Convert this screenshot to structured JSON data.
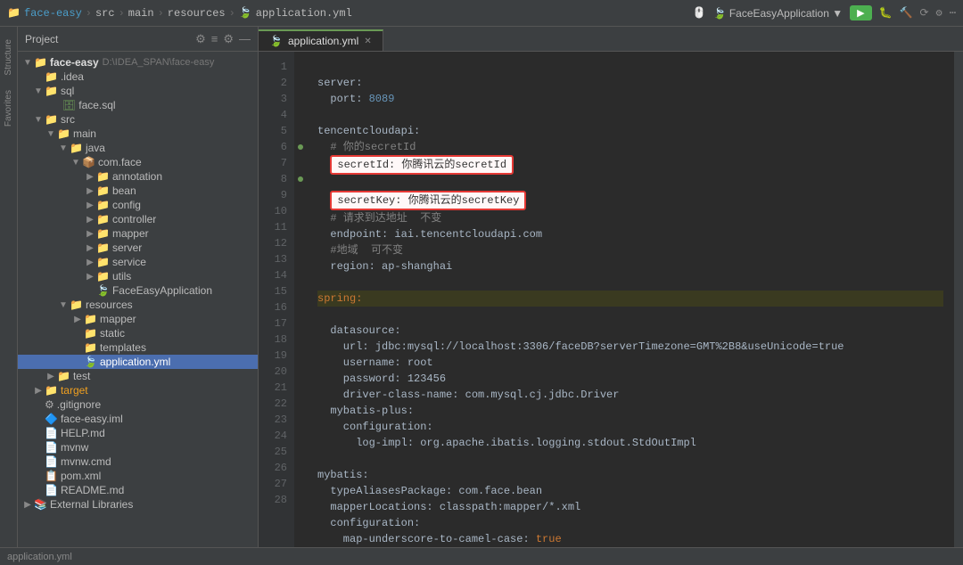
{
  "topbar": {
    "breadcrumb": [
      "face-easy",
      "src",
      "main",
      "resources",
      "application.yml"
    ],
    "app_name": "FaceEasyApplication",
    "run_icon": "▶",
    "debug_icon": "🐛",
    "build_icon": "🔨"
  },
  "sidebar": {
    "title": "Project",
    "tree": [
      {
        "id": "face-easy-root",
        "label": "face-easy",
        "path": "D:\\IDEA_SPAN\\face-easy",
        "type": "project",
        "level": 0,
        "expanded": true,
        "arrow": "▼"
      },
      {
        "id": "idea",
        "label": ".idea",
        "type": "folder",
        "level": 1,
        "expanded": false,
        "arrow": "▶"
      },
      {
        "id": "sql",
        "label": "sql",
        "type": "folder",
        "level": 1,
        "expanded": true,
        "arrow": "▼"
      },
      {
        "id": "face-sql",
        "label": "face.sql",
        "type": "sql",
        "level": 2,
        "expanded": false,
        "arrow": ""
      },
      {
        "id": "src",
        "label": "src",
        "type": "folder",
        "level": 1,
        "expanded": true,
        "arrow": "▼"
      },
      {
        "id": "main",
        "label": "main",
        "type": "folder",
        "level": 2,
        "expanded": true,
        "arrow": "▼"
      },
      {
        "id": "java",
        "label": "java",
        "type": "folder",
        "level": 3,
        "expanded": true,
        "arrow": "▼"
      },
      {
        "id": "com-face",
        "label": "com.face",
        "type": "package",
        "level": 4,
        "expanded": true,
        "arrow": "▼"
      },
      {
        "id": "annotation",
        "label": "annotation",
        "type": "folder",
        "level": 5,
        "expanded": false,
        "arrow": "▶"
      },
      {
        "id": "bean",
        "label": "bean",
        "type": "folder",
        "level": 5,
        "expanded": false,
        "arrow": "▶"
      },
      {
        "id": "config",
        "label": "config",
        "type": "folder",
        "level": 5,
        "expanded": false,
        "arrow": "▶"
      },
      {
        "id": "controller",
        "label": "controller",
        "type": "folder",
        "level": 5,
        "expanded": false,
        "arrow": "▶"
      },
      {
        "id": "mapper",
        "label": "mapper",
        "type": "folder",
        "level": 5,
        "expanded": false,
        "arrow": "▶"
      },
      {
        "id": "server",
        "label": "server",
        "type": "folder",
        "level": 5,
        "expanded": false,
        "arrow": "▶"
      },
      {
        "id": "service",
        "label": "service",
        "type": "folder",
        "level": 5,
        "expanded": false,
        "arrow": "▶"
      },
      {
        "id": "utils",
        "label": "utils",
        "type": "folder",
        "level": 5,
        "expanded": false,
        "arrow": "▶"
      },
      {
        "id": "FaceEasyApplication",
        "label": "FaceEasyApplication",
        "type": "app",
        "level": 5,
        "expanded": false,
        "arrow": ""
      },
      {
        "id": "resources",
        "label": "resources",
        "type": "folder",
        "level": 3,
        "expanded": true,
        "arrow": "▼"
      },
      {
        "id": "mapper-res",
        "label": "mapper",
        "type": "folder",
        "level": 4,
        "expanded": false,
        "arrow": "▶"
      },
      {
        "id": "static",
        "label": "static",
        "type": "folder",
        "level": 4,
        "expanded": false,
        "arrow": ""
      },
      {
        "id": "templates",
        "label": "templates",
        "type": "folder",
        "level": 4,
        "expanded": false,
        "arrow": ""
      },
      {
        "id": "application-yml",
        "label": "application.yml",
        "type": "yaml",
        "level": 4,
        "expanded": false,
        "arrow": "",
        "selected": true
      },
      {
        "id": "test",
        "label": "test",
        "type": "folder",
        "level": 2,
        "expanded": false,
        "arrow": "▶"
      },
      {
        "id": "target",
        "label": "target",
        "type": "folder",
        "level": 1,
        "expanded": false,
        "arrow": "▶",
        "highlight": true
      },
      {
        "id": "gitignore",
        "label": ".gitignore",
        "type": "git",
        "level": 1,
        "expanded": false,
        "arrow": ""
      },
      {
        "id": "face-easy-iml",
        "label": "face-easy.iml",
        "type": "iml",
        "level": 1,
        "expanded": false,
        "arrow": ""
      },
      {
        "id": "HELP-md",
        "label": "HELP.md",
        "type": "md",
        "level": 1,
        "expanded": false,
        "arrow": ""
      },
      {
        "id": "mvnw",
        "label": "mvnw",
        "type": "file",
        "level": 1,
        "expanded": false,
        "arrow": ""
      },
      {
        "id": "mvnw-cmd",
        "label": "mvnw.cmd",
        "type": "file",
        "level": 1,
        "expanded": false,
        "arrow": ""
      },
      {
        "id": "pom-xml",
        "label": "pom.xml",
        "type": "xml",
        "level": 1,
        "expanded": false,
        "arrow": ""
      },
      {
        "id": "README-md",
        "label": "README.md",
        "type": "md",
        "level": 1,
        "expanded": false,
        "arrow": ""
      },
      {
        "id": "External Libraries",
        "label": "External Libraries",
        "type": "folder",
        "level": 0,
        "expanded": false,
        "arrow": "▶"
      }
    ]
  },
  "editor": {
    "tab_label": "application.yml",
    "tab_icon": "yaml",
    "lines": [
      {
        "num": 1,
        "content": "server:",
        "type": "key"
      },
      {
        "num": 2,
        "content": "  port: 8089",
        "type": "keyval",
        "key": "  port",
        "val": " 8089"
      },
      {
        "num": 3,
        "content": "",
        "type": "empty"
      },
      {
        "num": 4,
        "content": "tencentcloudapi:",
        "type": "key"
      },
      {
        "num": 5,
        "content": "  # 你的secretId",
        "type": "comment"
      },
      {
        "num": 6,
        "content": "  secretId: 你腾讯云的secretId",
        "type": "keyval",
        "key": "  secretId",
        "val": " 你腾讯云的secretId",
        "redbox": true
      },
      {
        "num": 7,
        "content": "",
        "type": "empty"
      },
      {
        "num": 8,
        "content": "  secretKey: 你腾讯云的secretKey",
        "type": "keyval",
        "key": "  secretKey",
        "val": " 你腾讯云的secretKey",
        "redbox": true
      },
      {
        "num": 9,
        "content": "  # 请求到达地址  不变",
        "type": "comment"
      },
      {
        "num": 10,
        "content": "  endpoint: iai.tencentcloudapi.com",
        "type": "keyval",
        "key": "  endpoint",
        "val": " iai.tencentcloudapi.com"
      },
      {
        "num": 11,
        "content": "  #地域  可不变",
        "type": "comment"
      },
      {
        "num": 12,
        "content": "  region: ap-shanghai",
        "type": "keyval",
        "key": "  region",
        "val": " ap-shanghai"
      },
      {
        "num": 13,
        "content": "",
        "type": "empty"
      },
      {
        "num": 14,
        "content": "spring:",
        "type": "key-spring",
        "highlight": true
      },
      {
        "num": 15,
        "content": "  datasource:",
        "type": "key-sub"
      },
      {
        "num": 16,
        "content": "    url: jdbc:mysql://localhost:3306/faceDB?serverTimezone=GMT%2B8&useUnicode=true",
        "type": "keyval",
        "key": "    url",
        "val": " jdbc:mysql://localhost:3306/faceDB?serverTimezone=GMT%2B8&useUnicode=true"
      },
      {
        "num": 17,
        "content": "    username: root",
        "type": "keyval",
        "key": "    username",
        "val": " root"
      },
      {
        "num": 18,
        "content": "    password: 123456",
        "type": "keyval",
        "key": "    password",
        "val": " 123456"
      },
      {
        "num": 19,
        "content": "    driver-class-name: com.mysql.cj.jdbc.Driver",
        "type": "keyval",
        "key": "    driver-class-name",
        "val": " com.mysql.cj.jdbc.Driver"
      },
      {
        "num": 20,
        "content": "  mybatis-plus:",
        "type": "key-sub"
      },
      {
        "num": 21,
        "content": "    configuration:",
        "type": "key-sub"
      },
      {
        "num": 22,
        "content": "      log-impl: org.apache.ibatis.logging.stdout.StdOutImpl",
        "type": "keyval",
        "key": "      log-impl",
        "val": " org.apache.ibatis.logging.stdout.StdOutImpl"
      },
      {
        "num": 23,
        "content": "",
        "type": "empty"
      },
      {
        "num": 24,
        "content": "mybatis:",
        "type": "key"
      },
      {
        "num": 25,
        "content": "  typeAliasesPackage: com.face.bean",
        "type": "keyval",
        "key": "  typeAliasesPackage",
        "val": " com.face.bean"
      },
      {
        "num": 26,
        "content": "  mapperLocations: classpath:mapper/*.xml",
        "type": "keyval",
        "key": "  mapperLocations",
        "val": " classpath:mapper/*.xml"
      },
      {
        "num": 27,
        "content": "  configuration:",
        "type": "key-sub"
      },
      {
        "num": 28,
        "content": "    map-underscore-to-camel-case: true",
        "type": "keyval",
        "key": "    map-underscore-to-camel-case",
        "val": " true"
      }
    ]
  },
  "colors": {
    "key": "#a9b7c6",
    "val_green": "#6a9955",
    "val_num": "#6897bb",
    "comment": "#808080",
    "spring_orange": "#cc7832",
    "background": "#2b2b2b",
    "sidebar_bg": "#3c3f41",
    "line_num_bg": "#313335",
    "line_num_color": "#606366",
    "selected_bg": "#4b6eaf",
    "highlight_yellow": "#fffde7",
    "red_box": "#e53935"
  }
}
